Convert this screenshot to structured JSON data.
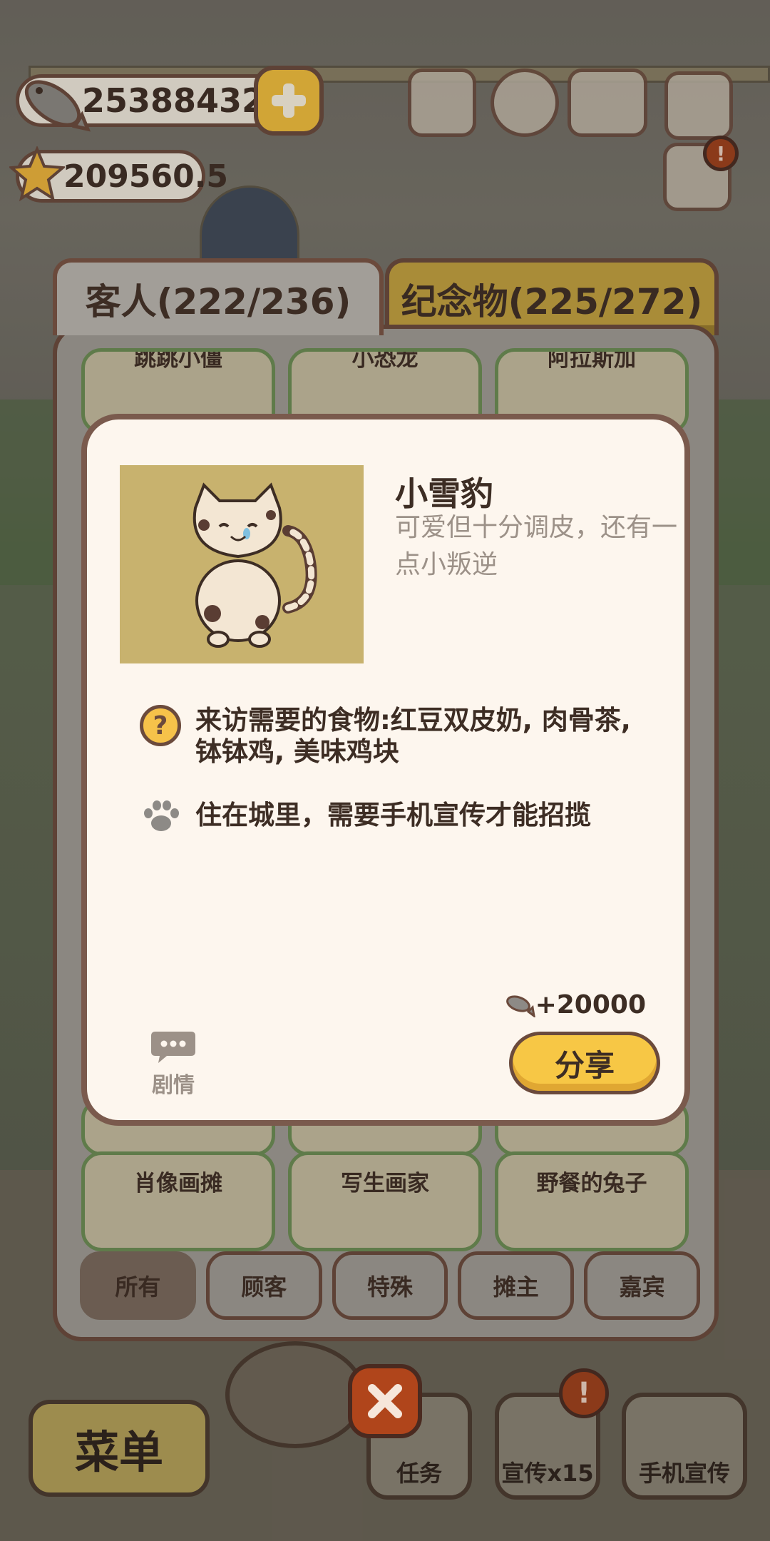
{
  "currency": {
    "fish": "253884324",
    "stars": "209560.5"
  },
  "top_icons": [
    "ranking-icon",
    "settings-gear-icon",
    "guestbook-icon",
    "camera-icon",
    "mail-icon"
  ],
  "tabs": {
    "guests": "客人(222/236)",
    "souvenirs": "纪念物(225/272)"
  },
  "grid": {
    "top_row": [
      "跳跳小僵",
      "小恐龙",
      "阿拉斯加"
    ],
    "bottom_row": [
      "肖像画摊",
      "写生画家",
      "野餐的兔子"
    ]
  },
  "detail": {
    "name": "小雪豹",
    "description": "可爱但十分调皮，还有一点小叛逆",
    "food_requirement": "来访需要的食物:红豆双皮奶, 肉骨茶, 钵钵鸡, 美味鸡块",
    "recruit_hint": "住在城里，需要手机宣传才能招揽",
    "reward": "+20000",
    "share_label": "分享",
    "story_label": "剧情"
  },
  "filters": [
    "所有",
    "顾客",
    "特殊",
    "摊主",
    "嘉宾"
  ],
  "hud": {
    "menu": "菜单",
    "tasks": "任务",
    "promo": "宣传x15",
    "phone_promo": "手机宣传"
  },
  "colors": {
    "accent_yellow": "#f7c745",
    "outline_brown": "#6b4a3c",
    "card_cream": "#fdf6ee",
    "portrait_bg": "#c8b26e",
    "close_red": "#b0451b"
  }
}
